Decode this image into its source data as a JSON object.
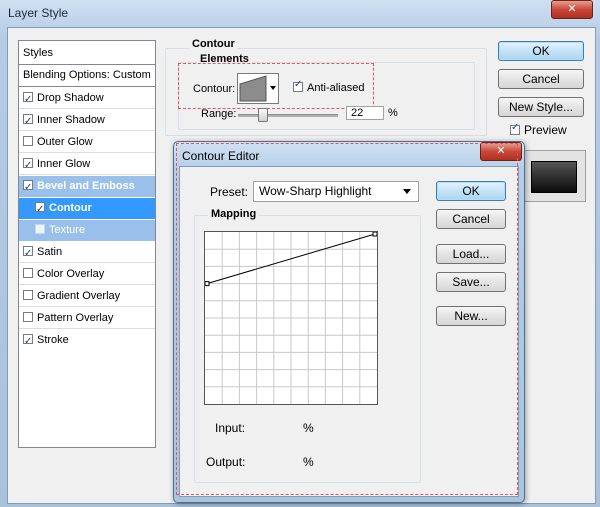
{
  "window": {
    "title": "Layer Style",
    "close_glyph": "✕"
  },
  "styles_list": {
    "header": "Styles",
    "blending": "Blending Options: Custom",
    "items": [
      {
        "label": "Drop Shadow",
        "checked": true
      },
      {
        "label": "Inner Shadow",
        "checked": true
      },
      {
        "label": "Outer Glow",
        "checked": false
      },
      {
        "label": "Inner Glow",
        "checked": true
      },
      {
        "label": "Bevel and Emboss",
        "checked": true
      },
      {
        "label": "Contour",
        "checked": true
      },
      {
        "label": "Texture",
        "checked": false
      },
      {
        "label": "Satin",
        "checked": true
      },
      {
        "label": "Color Overlay",
        "checked": false
      },
      {
        "label": "Gradient Overlay",
        "checked": false
      },
      {
        "label": "Pattern Overlay",
        "checked": false
      },
      {
        "label": "Stroke",
        "checked": true
      }
    ]
  },
  "buttons": {
    "ok": "OK",
    "cancel": "Cancel",
    "new_style": "New Style...",
    "preview": "Preview"
  },
  "contour_panel": {
    "title": "Contour",
    "group": "Elements",
    "contour_label": "Contour:",
    "anti_aliased": "Anti-aliased",
    "range_label": "Range:",
    "range_value": "22",
    "percent": "%"
  },
  "contour_editor": {
    "title": "Contour Editor",
    "preset_label": "Preset:",
    "preset_value": "Wow-Sharp Highlight",
    "ok": "OK",
    "cancel": "Cancel",
    "load": "Load...",
    "save": "Save...",
    "new": "New...",
    "mapping": "Mapping",
    "input_label": "Input:",
    "output_label": "Output:",
    "percent": "%",
    "curve_points": [
      {
        "input": 0,
        "output": 70
      },
      {
        "input": 100,
        "output": 100
      }
    ]
  },
  "colors": {
    "selection": "#3399ff",
    "highlight_dash": "#e2545f"
  }
}
